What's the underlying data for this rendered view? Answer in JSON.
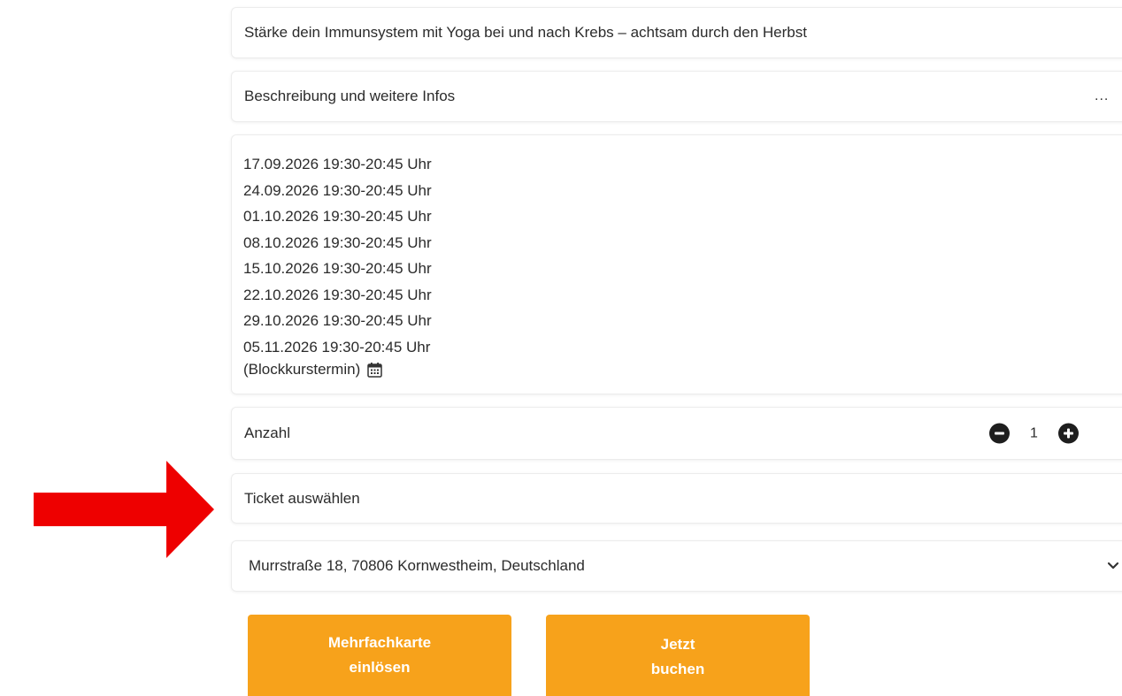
{
  "course": {
    "title": "Stärke dein Immunsystem mit Yoga bei und nach Krebs – achtsam durch den Herbst"
  },
  "info": {
    "label": "Beschreibung und weitere Infos",
    "more": "..."
  },
  "dates": [
    "17.09.2026 19:30-20:45 Uhr",
    "24.09.2026 19:30-20:45 Uhr",
    "01.10.2026 19:30-20:45 Uhr",
    "08.10.2026 19:30-20:45 Uhr",
    "15.10.2026 19:30-20:45 Uhr",
    "22.10.2026 19:30-20:45 Uhr",
    "29.10.2026 19:30-20:45 Uhr",
    "05.11.2026 19:30-20:45 Uhr"
  ],
  "block_note": "(Blockkurstermin)",
  "quantity": {
    "label": "Anzahl",
    "value": "1"
  },
  "ticket": {
    "label": "Ticket auswählen"
  },
  "location": {
    "selected": "Murrstraße 18, 70806 Kornwestheim, Deutschland"
  },
  "buttons": {
    "multi_line1": "Mehrfachkarte",
    "multi_line2": "einlösen",
    "book_line1": "Jetzt",
    "book_line2": "buchen"
  },
  "icons": {
    "calendar": "calendar-icon",
    "minus": "minus-circle-icon",
    "plus": "plus-circle-icon",
    "chevron": "chevron-down-icon",
    "arrow": "red-arrow-right"
  },
  "colors": {
    "button": "#f7a21b",
    "arrow": "#ee0000",
    "stepper": "#1e1e1e"
  }
}
